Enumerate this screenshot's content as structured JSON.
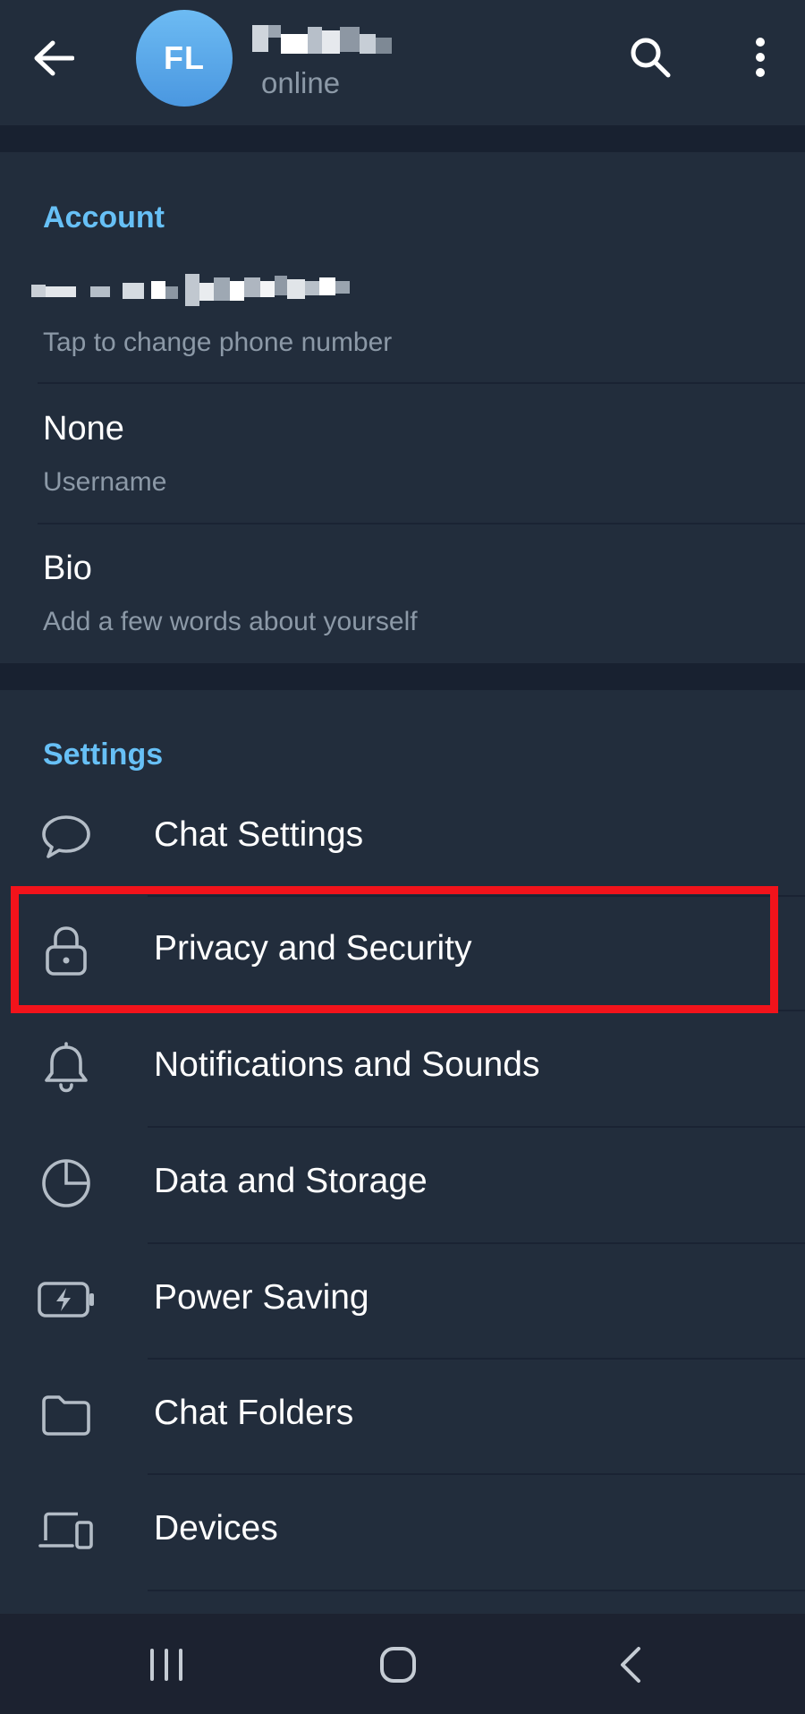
{
  "header": {
    "avatar_initials": "FL",
    "status": "online",
    "avatar_color": "#5aa8ea"
  },
  "account": {
    "title": "Account",
    "phone_hint": "Tap to change phone number",
    "username_value": "None",
    "username_label": "Username",
    "bio_label": "Bio",
    "bio_hint": "Add a few words about yourself"
  },
  "settings": {
    "title": "Settings",
    "items": [
      {
        "label": "Chat Settings",
        "icon": "chat-bubble-icon"
      },
      {
        "label": "Privacy and Security",
        "icon": "lock-icon"
      },
      {
        "label": "Notifications and Sounds",
        "icon": "bell-icon"
      },
      {
        "label": "Data and Storage",
        "icon": "pie-chart-icon"
      },
      {
        "label": "Power Saving",
        "icon": "battery-icon"
      },
      {
        "label": "Chat Folders",
        "icon": "folder-icon"
      },
      {
        "label": "Devices",
        "icon": "devices-icon"
      }
    ]
  },
  "highlight_color": "#f2131b",
  "accent_color": "#67c0f6"
}
